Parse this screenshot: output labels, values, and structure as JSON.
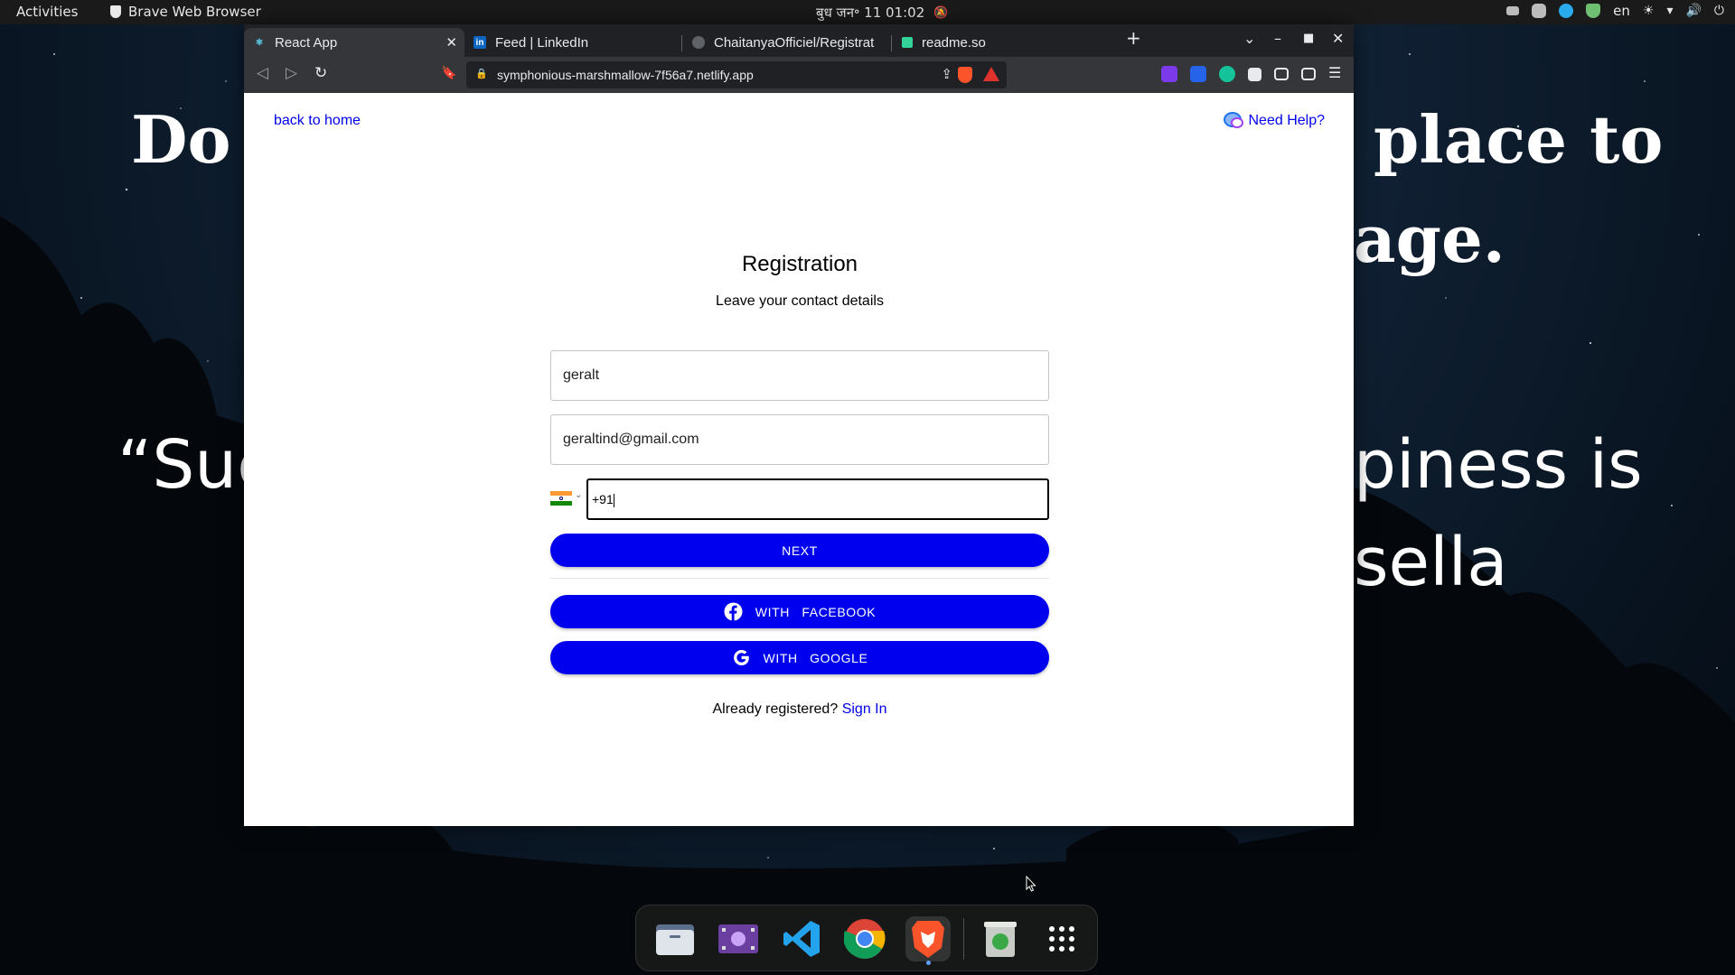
{
  "topbar": {
    "activities": "Activities",
    "app_name": "Brave Web Browser",
    "clock": "बुध जन॰ 11  01:02",
    "lang": "en"
  },
  "background_text": {
    "line1_left": "Do",
    "line1_right": "place to",
    "line2_right": "age.",
    "line3_left": "“Suc",
    "line3_right": "piness is",
    "line4_right": "sella"
  },
  "browser": {
    "tabs": [
      {
        "label": "React App",
        "active": true,
        "favicon": "react-icon"
      },
      {
        "label": "Feed | LinkedIn",
        "active": false,
        "favicon": "linkedin-icon"
      },
      {
        "label": "ChaitanyaOfficiel/Registrat",
        "active": false,
        "favicon": "github-icon"
      },
      {
        "label": "readme.so",
        "active": false,
        "favicon": "readme-icon"
      }
    ],
    "url": "symphonious-marshmallow-7f56a7.netlify.app"
  },
  "page": {
    "back_link": "back to home",
    "help_link": "Need Help?",
    "title": "Registration",
    "subtitle": "Leave your contact details",
    "name_value": "geralt",
    "email_value": "geraltind@gmail.com",
    "phone_value": "+91",
    "next_label": "NEXT",
    "facebook_label": "WITH   FACEBOOK",
    "google_label": "WITH   GOOGLE",
    "already_text": "Already registered?",
    "sign_in_label": "Sign In"
  },
  "dock": {
    "items": [
      "files-icon",
      "video-editor-icon",
      "vscode-icon",
      "chrome-icon",
      "brave-icon",
      "trash-icon",
      "app-grid-icon"
    ]
  },
  "colors": {
    "accent_blue": "#0000ee",
    "link_blue": "#0000ee"
  }
}
